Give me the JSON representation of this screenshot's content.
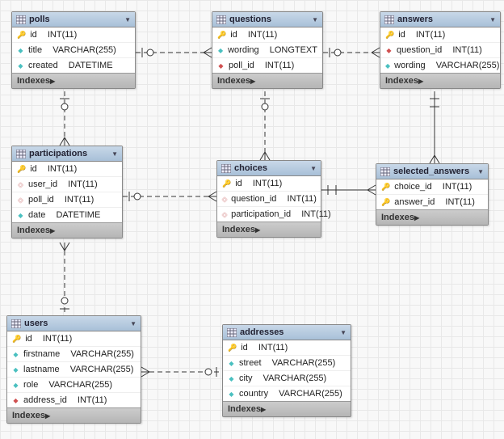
{
  "diagram": {
    "type": "entity-relationship",
    "indexes_label": "Indexes"
  },
  "tables": {
    "polls": {
      "title": "polls",
      "columns": [
        {
          "name": "id",
          "type": "INT(11)",
          "key": "pk"
        },
        {
          "name": "title",
          "type": "VARCHAR(255)",
          "key": "attr"
        },
        {
          "name": "created",
          "type": "DATETIME",
          "key": "attr"
        }
      ]
    },
    "questions": {
      "title": "questions",
      "columns": [
        {
          "name": "id",
          "type": "INT(11)",
          "key": "pk"
        },
        {
          "name": "wording",
          "type": "LONGTEXT",
          "key": "attr"
        },
        {
          "name": "poll_id",
          "type": "INT(11)",
          "key": "fk"
        }
      ]
    },
    "answers": {
      "title": "answers",
      "columns": [
        {
          "name": "id",
          "type": "INT(11)",
          "key": "pk"
        },
        {
          "name": "question_id",
          "type": "INT(11)",
          "key": "fk"
        },
        {
          "name": "wording",
          "type": "VARCHAR(255)",
          "key": "attr"
        }
      ]
    },
    "participations": {
      "title": "participations",
      "columns": [
        {
          "name": "id",
          "type": "INT(11)",
          "key": "pk"
        },
        {
          "name": "user_id",
          "type": "INT(11)",
          "key": "fk-nullable"
        },
        {
          "name": "poll_id",
          "type": "INT(11)",
          "key": "fk-nullable"
        },
        {
          "name": "date",
          "type": "DATETIME",
          "key": "attr"
        }
      ]
    },
    "choices": {
      "title": "choices",
      "columns": [
        {
          "name": "id",
          "type": "INT(11)",
          "key": "pk"
        },
        {
          "name": "question_id",
          "type": "INT(11)",
          "key": "fk-nullable"
        },
        {
          "name": "participation_id",
          "type": "INT(11)",
          "key": "fk-nullable"
        }
      ]
    },
    "selected_answers": {
      "title": "selected_answers",
      "columns": [
        {
          "name": "choice_id",
          "type": "INT(11)",
          "key": "pk"
        },
        {
          "name": "answer_id",
          "type": "INT(11)",
          "key": "pk"
        }
      ]
    },
    "users": {
      "title": "users",
      "columns": [
        {
          "name": "id",
          "type": "INT(11)",
          "key": "pk"
        },
        {
          "name": "firstname",
          "type": "VARCHAR(255)",
          "key": "attr"
        },
        {
          "name": "lastname",
          "type": "VARCHAR(255)",
          "key": "attr"
        },
        {
          "name": "role",
          "type": "VARCHAR(255)",
          "key": "attr"
        },
        {
          "name": "address_id",
          "type": "INT(11)",
          "key": "fk"
        }
      ]
    },
    "addresses": {
      "title": "addresses",
      "columns": [
        {
          "name": "id",
          "type": "INT(11)",
          "key": "pk"
        },
        {
          "name": "street",
          "type": "VARCHAR(255)",
          "key": "attr"
        },
        {
          "name": "city",
          "type": "VARCHAR(255)",
          "key": "attr"
        },
        {
          "name": "country",
          "type": "VARCHAR(255)",
          "key": "attr"
        }
      ]
    }
  },
  "relationships": [
    {
      "from": "questions.poll_id",
      "to": "polls.id",
      "type": "many-to-one",
      "optional": true
    },
    {
      "from": "answers.question_id",
      "to": "questions.id",
      "type": "many-to-one",
      "optional": true
    },
    {
      "from": "choices.question_id",
      "to": "questions.id",
      "type": "many-to-one",
      "optional": true
    },
    {
      "from": "choices.participation_id",
      "to": "participations.id",
      "type": "many-to-one",
      "optional": true
    },
    {
      "from": "selected_answers.choice_id",
      "to": "choices.id",
      "type": "many-to-one",
      "optional": false
    },
    {
      "from": "selected_answers.answer_id",
      "to": "answers.id",
      "type": "many-to-one",
      "optional": false
    },
    {
      "from": "participations.poll_id",
      "to": "polls.id",
      "type": "many-to-one",
      "optional": true
    },
    {
      "from": "participations.user_id",
      "to": "users.id",
      "type": "many-to-one",
      "optional": true
    },
    {
      "from": "users.address_id",
      "to": "addresses.id",
      "type": "many-to-one",
      "optional": true
    }
  ]
}
